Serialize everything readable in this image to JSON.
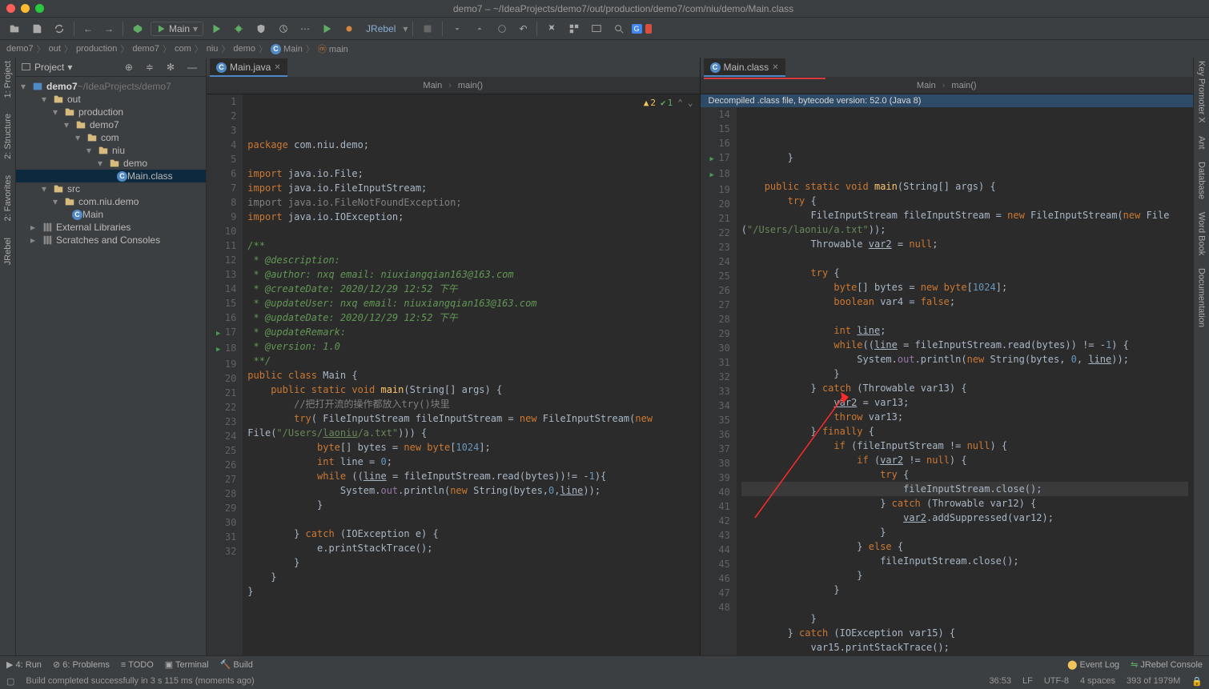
{
  "title": "demo7 – ~/IdeaProjects/demo7/out/production/demo7/com/niu/demo/Main.class",
  "runConfig": "Main",
  "jrebelLabel": "JRebel",
  "breadcrumb": [
    "demo7",
    "out",
    "production",
    "demo7",
    "com",
    "niu",
    "demo",
    "Main",
    "main"
  ],
  "projectLabel": "Project",
  "tree": {
    "root": {
      "name": "demo7",
      "path": "~/IdeaProjects/demo7"
    },
    "items": [
      {
        "name": "out",
        "d": 1
      },
      {
        "name": "production",
        "d": 2
      },
      {
        "name": "demo7",
        "d": 3
      },
      {
        "name": "com",
        "d": 4
      },
      {
        "name": "niu",
        "d": 5
      },
      {
        "name": "demo",
        "d": 6
      },
      {
        "name": "Main.class",
        "d": 7,
        "file": true,
        "sel": true
      },
      {
        "name": "src",
        "d": 1,
        "collapsed": false
      },
      {
        "name": "com.niu.demo",
        "d": 2
      },
      {
        "name": "Main",
        "d": 3,
        "file": true
      },
      {
        "name": "External Libraries",
        "d": 0,
        "lib": true
      },
      {
        "name": "Scratches and Consoles",
        "d": 0,
        "lib": true
      }
    ]
  },
  "leftEditor": {
    "tab": "Main.java",
    "bc": [
      "Main",
      "main()"
    ],
    "warnings": {
      "yellow": "2",
      "green": "1"
    },
    "startLine": 1,
    "lines": [
      "<span class='k'>package</span> com.niu.demo;",
      "",
      "<span class='k'>import</span> java.io.File;",
      "<span class='k'>import</span> java.io.FileInputStream;",
      "<span class='c'>import java.io.FileNotFoundException;</span>",
      "<span class='k'>import</span> java.io.IOException;",
      "",
      "<span class='jd'>/**</span>",
      "<span class='jd'> * @description:</span>",
      "<span class='jd'> * @author: nxq email: niuxiangqian163@163.com</span>",
      "<span class='jd'> * @createDate: 2020/12/29 12:52 下午</span>",
      "<span class='jd'> * @updateUser: nxq email: niuxiangqian163@163.com</span>",
      "<span class='jd'> * @updateDate: 2020/12/29 12:52 下午</span>",
      "<span class='jd'> * @updateRemark:</span>",
      "<span class='jd'> * @version: 1.0</span>",
      "<span class='jd'> **/</span>",
      "<span class='k'>public class</span> Main {",
      "    <span class='k'>public static void</span> <span class='m'>main</span>(String[] args) {",
      "        <span class='c'>//把打开流的操作都放入try()块里</span>",
      "        <span class='k'>try</span>( FileInputStream fileInputStream = <span class='k'>new</span> FileInputStream(<span class='k'>new</span> ",
      "File(<span class='s'>\"/Users/<u>laoniu</u>/a.txt\"</span>))) {",
      "            <span class='k'>byte</span>[] bytes = <span class='k'>new byte</span>[<span class='n'>1024</span>];",
      "            <span class='k'>int</span> line = <span class='n'>0</span>;",
      "            <span class='k'>while</span> ((<u>line</u> = fileInputStream.read(bytes))!= -<span class='n'>1</span>){",
      "                System.<span class='f'>out</span>.println(<span class='k'>new</span> String(bytes,<span class='n'>0</span>,<u>line</u>));",
      "            }",
      "",
      "        } <span class='k'>catch</span> (IOException e) {",
      "            e.printStackTrace();",
      "        }",
      "    }",
      "}",
      ""
    ],
    "lineNumbers": [
      1,
      2,
      3,
      4,
      5,
      6,
      7,
      8,
      9,
      10,
      11,
      12,
      13,
      14,
      15,
      16,
      17,
      18,
      19,
      20,
      "",
      21,
      22,
      23,
      24,
      25,
      26,
      27,
      28,
      29,
      30,
      31,
      32
    ]
  },
  "rightEditor": {
    "tab": "Main.class",
    "bc": [
      "Main",
      "main()"
    ],
    "banner": "Decompiled .class file, bytecode version: 52.0 (Java 8)",
    "startLine": 14,
    "lines": [
      "        }",
      "",
      "    <span class='k'>public static void</span> <span class='m'>main</span>(String[] args) {",
      "        <span class='k'>try</span> {",
      "            FileInputStream fileInputStream = <span class='k'>new</span> FileInputStream(<span class='k'>new</span> File",
      "(<span class='s'>\"/Users/laoniu/a.txt\"</span>));",
      "            Throwable <u>var2</u> = <span class='k'>null</span>;",
      "",
      "            <span class='k'>try</span> {",
      "                <span class='k'>byte</span>[] bytes = <span class='k'>new byte</span>[<span class='n'>1024</span>];",
      "                <span class='k'>boolean</span> var4 = <span class='k'>false</span>;",
      "",
      "                <span class='k'>int</span> <u>line</u>;",
      "                <span class='k'>while</span>((<u>line</u> = fileInputStream.read(bytes)) != -<span class='n'>1</span>) {",
      "                    System.<span class='f'>out</span>.println(<span class='k'>new</span> String(bytes, <span class='n'>0</span>, <u>line</u>));",
      "                }",
      "            } <span class='k'>catch</span> (Throwable var13) {",
      "                <u>var2</u> = var13;",
      "                <span class='k'>throw</span> var13;",
      "            } <span class='k'>finally</span> {",
      "                <span class='k'>if</span> (fileInputStream != <span class='k'>null</span>) {",
      "                    <span class='k'>if</span> (<u>var2</u> != <span class='k'>null</span>) {",
      "                        <span class='k'>try</span> {",
      "                            fileInputStream.close();",
      "                        } <span class='k'>catch</span> (Throwable var12) {",
      "                            <u>var2</u>.addSuppressed(var12);",
      "                        }",
      "                    } <span class='k'>else</span> {",
      "                        fileInputStream.close();",
      "                    }",
      "                }",
      "",
      "            }",
      "        } <span class='k'>catch</span> (IOException var15) {",
      "            var15.printStackTrace();",
      "        }"
    ],
    "lineNumbers": [
      14,
      15,
      16,
      17,
      18,
      "",
      19,
      20,
      21,
      22,
      23,
      24,
      25,
      26,
      27,
      28,
      29,
      30,
      31,
      32,
      33,
      34,
      35,
      36,
      37,
      38,
      39,
      40,
      41,
      42,
      43,
      44,
      45,
      46,
      47,
      48
    ]
  },
  "bottomTabs": [
    "4: Run",
    "6: Problems",
    "TODO",
    "Terminal",
    "Build"
  ],
  "bottomRight": [
    "Event Log",
    "JRebel Console"
  ],
  "statusMsg": "Build completed successfully in 3 s 115 ms (moments ago)",
  "statusRight": [
    "36:53",
    "LF",
    "UTF-8",
    "4 spaces",
    "393 of 1979M"
  ],
  "sideLeft": [
    "1: Project",
    "2: Structure",
    "2: Favorites",
    "JRebel"
  ],
  "sideRight": [
    "Key Promoter X",
    "Ant",
    "Database",
    "Word Book",
    "Documentation"
  ]
}
